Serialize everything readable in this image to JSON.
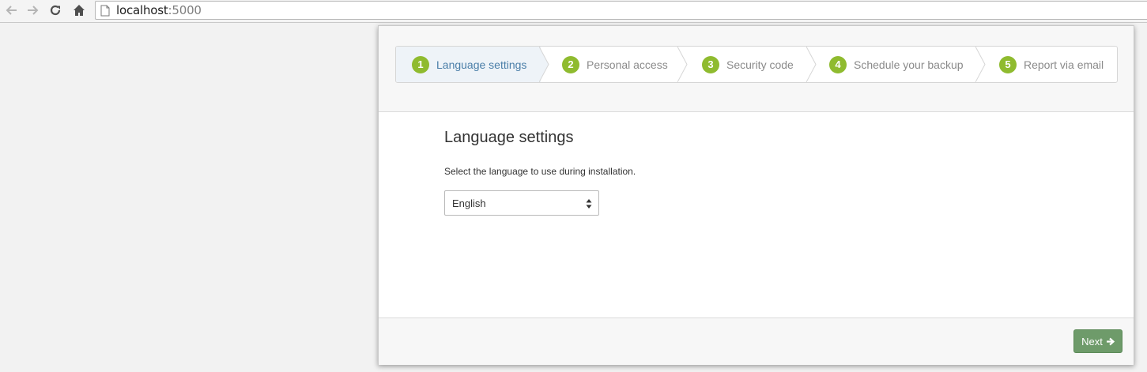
{
  "browser": {
    "url_host": "localhost",
    "url_port": ":5000",
    "back_icon": "arrow-left-icon",
    "forward_icon": "arrow-right-icon",
    "reload_icon": "reload-icon",
    "home_icon": "home-icon",
    "page_icon": "document-icon"
  },
  "wizard": {
    "steps": [
      {
        "number": "1",
        "label": "Language settings",
        "active": true
      },
      {
        "number": "2",
        "label": "Personal access",
        "active": false
      },
      {
        "number": "3",
        "label": "Security code",
        "active": false
      },
      {
        "number": "4",
        "label": "Schedule your backup",
        "active": false
      },
      {
        "number": "5",
        "label": "Report via email",
        "active": false
      }
    ],
    "title": "Language settings",
    "description": "Select the language to use during installation.",
    "language_select": {
      "selected": "English"
    },
    "next_label": "Next",
    "colors": {
      "step_badge": "#8fbb2f",
      "active_label": "#4a7ea8",
      "next_button": "#6e9b6a"
    }
  }
}
